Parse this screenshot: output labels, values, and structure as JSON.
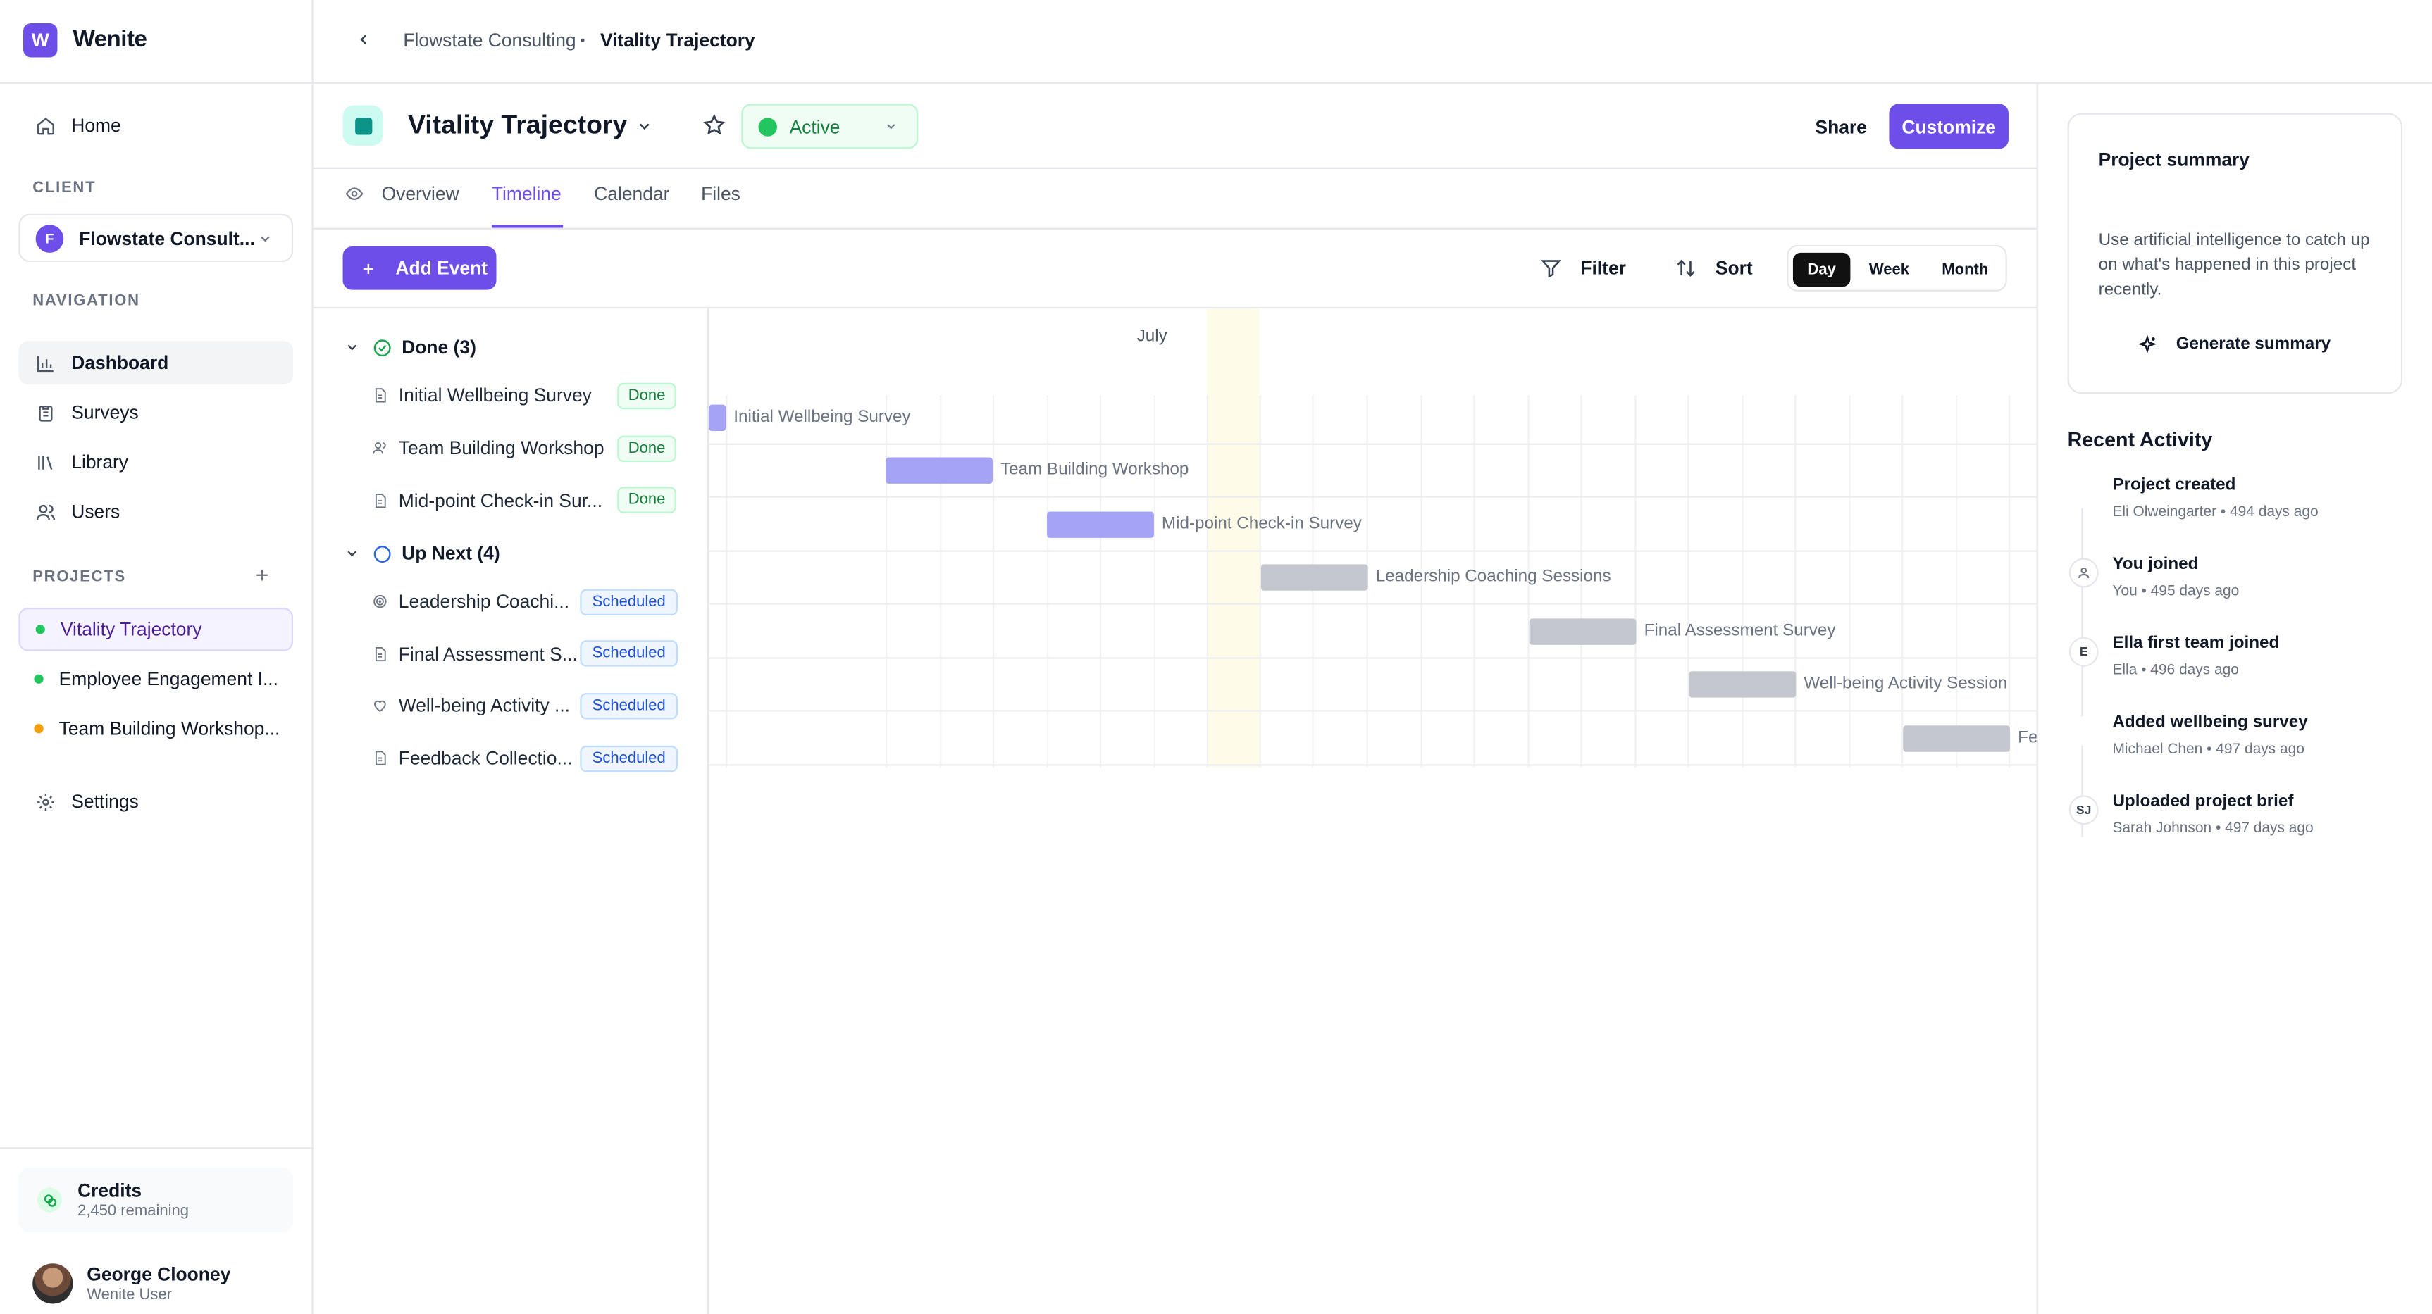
{
  "app": {
    "logo_letter": "W",
    "name": "Wenite"
  },
  "sidebar": {
    "home": "Home",
    "client_label": "CLIENT",
    "client": {
      "initial": "F",
      "name": "Flowstate Consult..."
    },
    "nav_label": "NAVIGATION",
    "nav": [
      {
        "label": "Dashboard",
        "icon": "bar-chart-icon"
      },
      {
        "label": "Surveys",
        "icon": "clipboard-icon"
      },
      {
        "label": "Library",
        "icon": "library-icon"
      },
      {
        "label": "Users",
        "icon": "users-icon"
      }
    ],
    "projects_label": "PROJECTS",
    "projects": [
      {
        "label": "Vitality Trajectory",
        "color": "#22c55e"
      },
      {
        "label": "Employee Engagement I...",
        "color": "#22c55e"
      },
      {
        "label": "Team Building Workshop...",
        "color": "#f59e0b"
      }
    ],
    "settings": "Settings",
    "credits": {
      "title": "Credits",
      "remaining": "2,450 remaining"
    },
    "user": {
      "name": "George Clooney",
      "role": "Wenite User"
    }
  },
  "breadcrumb": {
    "parent": "Flowstate Consulting",
    "separator": "•",
    "current": "Vitality Trajectory"
  },
  "project": {
    "title": "Vitality Trajectory",
    "status": "Active",
    "share": "Share",
    "customize": "Customize",
    "accent": "#6d4ee9"
  },
  "tabs": [
    "Overview",
    "Timeline",
    "Calendar",
    "Files"
  ],
  "toolbar": {
    "add_event": "Add Event",
    "filter": "Filter",
    "sort": "Sort",
    "views": [
      "Day",
      "Week",
      "Month"
    ],
    "active_view": "Day"
  },
  "groups": {
    "done": "Done (3)",
    "upnext": "Up Next (4)"
  },
  "events": [
    {
      "label": "Initial Wellbeing Survey",
      "list_label": "Initial Wellbeing Survey",
      "badge": "Done",
      "icon": "document-icon"
    },
    {
      "label": "Team Building Workshop",
      "list_label": "Team Building Workshop",
      "badge": "Done",
      "icon": "users-icon"
    },
    {
      "label": "Mid-point Check-in Survey",
      "list_label": "Mid-point Check-in Sur...",
      "badge": "Done",
      "icon": "document-icon"
    },
    {
      "label": "Leadership Coaching Sessions",
      "list_label": "Leadership Coachi...",
      "badge": "Scheduled",
      "icon": "target-icon"
    },
    {
      "label": "Final Assessment Survey",
      "list_label": "Final Assessment S...",
      "badge": "Scheduled",
      "icon": "document-icon"
    },
    {
      "label": "Well-being Activity Session",
      "list_label": "Well-being Activity ...",
      "badge": "Scheduled",
      "icon": "heart-icon"
    },
    {
      "label": "Fe",
      "list_label": "Feedback Collectio...",
      "badge": "Scheduled",
      "icon": "document-icon"
    }
  ],
  "timeline": {
    "month": "July"
  },
  "summary": {
    "title": "Project summary",
    "description": "Use artificial intelligence to catch up on what's happened in this project recently.",
    "button": "Generate summary"
  },
  "recent_activity": {
    "title": "Recent Activity",
    "items": [
      {
        "title": "Project created",
        "meta": "Eli Olweingarter • 494 days ago",
        "avatar": "photo"
      },
      {
        "title": "You joined",
        "meta": "You • 495 days ago",
        "avatar": "user-icon"
      },
      {
        "title": "Ella first team joined",
        "meta": "Ella • 496 days ago",
        "avatar": "E"
      },
      {
        "title": "Added wellbeing survey",
        "meta": "Michael Chen • 497 days ago",
        "avatar": "photo"
      },
      {
        "title": "Uploaded project brief",
        "meta": "Sarah Johnson • 497 days ago",
        "avatar": "SJ"
      }
    ]
  }
}
